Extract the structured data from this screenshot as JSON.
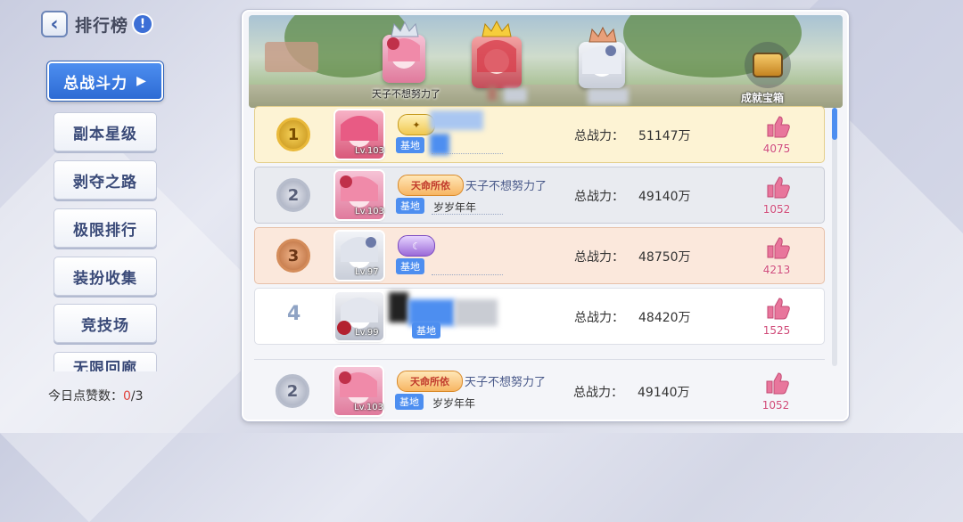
{
  "header": {
    "title": "排行榜",
    "back_icon": "chevron-left-icon",
    "info_icon": "info-icon"
  },
  "sidebar": {
    "items": [
      {
        "label": "总战斗力",
        "active": true
      },
      {
        "label": "副本星级"
      },
      {
        "label": "剥夺之路"
      },
      {
        "label": "极限排行"
      },
      {
        "label": "装扮收集"
      },
      {
        "label": "竞技场"
      },
      {
        "label": "无限回廊"
      }
    ],
    "likes_label": "今日点赞数：",
    "likes_used": "0",
    "likes_total": "/3"
  },
  "banner": {
    "podium": [
      {
        "rank": 2,
        "name": "天子不想努力了"
      },
      {
        "rank": 1,
        "name": ""
      },
      {
        "rank": 3,
        "name": ""
      }
    ],
    "chest_label": "成就宝箱"
  },
  "rows": [
    {
      "rank": "1",
      "medal": "gold",
      "level": "Lv.103",
      "title_badge": "",
      "partner": "",
      "base_tag": "基地",
      "clan": "",
      "power_label": "总战力：",
      "power": "51147万",
      "likes": "4075"
    },
    {
      "rank": "2",
      "medal": "silver",
      "level": "Lv.103",
      "title_badge": "天命所依",
      "partner": "天子不想努力了",
      "base_tag": "基地",
      "clan": "岁岁年年",
      "power_label": "总战力：",
      "power": "49140万",
      "likes": "1052"
    },
    {
      "rank": "3",
      "medal": "bronze",
      "level": "Lv.97",
      "title_badge": "",
      "partner": "",
      "base_tag": "基地",
      "clan": "",
      "power_label": "总战力：",
      "power": "48750万",
      "likes": "4213"
    },
    {
      "rank": "4",
      "medal": "none",
      "level": "Lv.99",
      "title_badge": "",
      "partner": "",
      "base_tag": "基地",
      "clan": "",
      "power_label": "总战力：",
      "power": "48420万",
      "likes": "1525"
    }
  ],
  "self_row": {
    "rank": "2",
    "level": "Lv.103",
    "title_badge": "天命所依",
    "partner": "天子不想努力了",
    "base_tag": "基地",
    "clan": "岁岁年年",
    "power_label": "总战力：",
    "power": "49140万",
    "likes": "1052"
  },
  "colors": {
    "accent": "#4d8ef0",
    "like": "#e8769c"
  }
}
